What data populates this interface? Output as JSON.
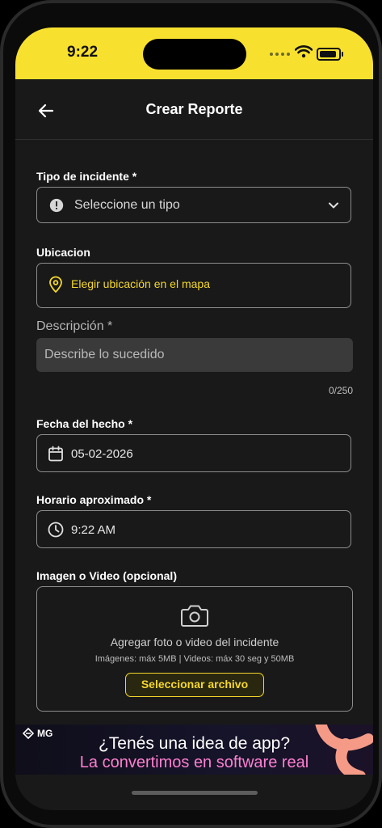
{
  "status": {
    "time": "9:22"
  },
  "header": {
    "title": "Crear Reporte"
  },
  "form": {
    "tipo": {
      "label": "Tipo de incidente *",
      "placeholder": "Seleccione un tipo"
    },
    "ubicacion": {
      "label": "Ubicacion",
      "action": "Elegir ubicación en el mapa"
    },
    "descripcion": {
      "label": "Descripción *",
      "placeholder": "Describe lo sucedido",
      "counter": "0/250"
    },
    "fecha": {
      "label": "Fecha del hecho *",
      "value": "05-02-2026"
    },
    "horario": {
      "label": "Horario aproximado *",
      "value": "9:22 AM"
    },
    "media": {
      "label": "Imagen o Video (opcional)",
      "title": "Agregar foto o video del incidente",
      "subtitle": "Imágenes: máx 5MB | Videos: máx 30 seg y 50MB",
      "button": "Seleccionar archivo"
    }
  },
  "banner": {
    "brand": "MG",
    "line1": "¿Tenés una idea de app?",
    "line2": "La convertimos en software real"
  },
  "colors": {
    "accent": "#f5d72a",
    "statusbar": "#f8e02f",
    "background": "#191919"
  }
}
